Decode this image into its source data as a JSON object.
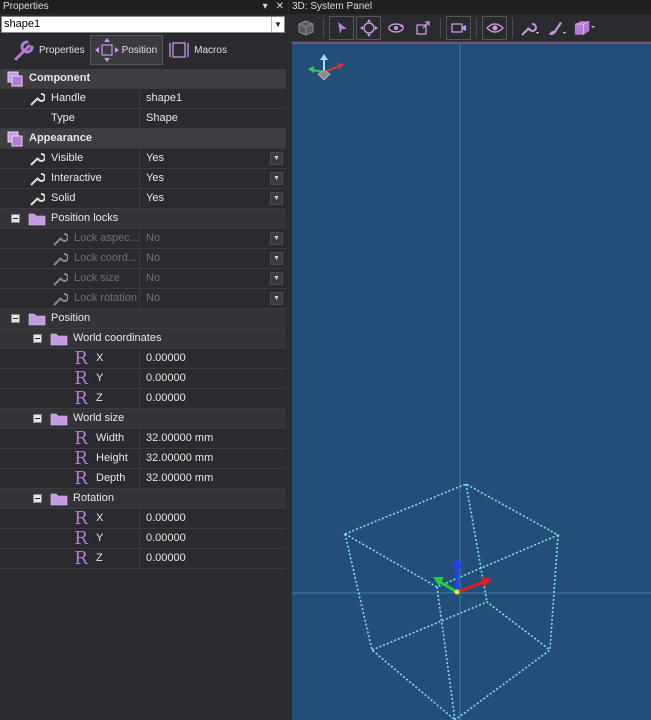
{
  "properties_panel": {
    "title": "Properties",
    "pin_icon": "pin-icon",
    "close_icon": "close-icon",
    "selected_object": "shape1",
    "tabs": [
      {
        "label": "Properties",
        "icon": "wrench-icon",
        "active": false
      },
      {
        "label": "Position",
        "icon": "move-arrows-icon",
        "active": true
      },
      {
        "label": "Macros",
        "icon": "macro-icon",
        "active": false
      }
    ],
    "sections": {
      "component": "Component",
      "appearance": "Appearance",
      "position_locks": "Position locks",
      "position": "Position",
      "world_coordinates": "World coordinates",
      "world_size": "World size",
      "rotation": "Rotation"
    },
    "rows": {
      "handle": {
        "label": "Handle",
        "value": "shape1"
      },
      "type": {
        "label": "Type",
        "value": "Shape"
      },
      "visible": {
        "label": "Visible",
        "value": "Yes"
      },
      "interactive": {
        "label": "Interactive",
        "value": "Yes"
      },
      "solid": {
        "label": "Solid",
        "value": "Yes"
      },
      "lock_aspect": {
        "label": "Lock aspec...",
        "value": "No"
      },
      "lock_coord": {
        "label": "Lock coord...",
        "value": "No"
      },
      "lock_size": {
        "label": "Lock size",
        "value": "No"
      },
      "lock_rotation": {
        "label": "Lock rotation",
        "value": "No"
      },
      "coord_x": {
        "label": "X",
        "value": "0.00000"
      },
      "coord_y": {
        "label": "Y",
        "value": "0.00000"
      },
      "coord_z": {
        "label": "Z",
        "value": "0.00000"
      },
      "width": {
        "label": "Width",
        "value": "32.00000 mm"
      },
      "height": {
        "label": "Height",
        "value": "32.00000 mm"
      },
      "depth": {
        "label": "Depth",
        "value": "32.00000 mm"
      },
      "rot_x": {
        "label": "X",
        "value": "0.00000"
      },
      "rot_y": {
        "label": "Y",
        "value": "0.00000"
      },
      "rot_z": {
        "label": "Z",
        "value": "0.00000"
      }
    },
    "colors": {
      "accent_purple": "#b47ad6",
      "folder": "#c59ae0"
    }
  },
  "system_panel": {
    "title": "3D: System Panel",
    "toolbar_icons": [
      "cube-view-icon",
      "select-arrow-icon",
      "move-icon",
      "rotate-icon",
      "scale-icon",
      "record-icon",
      "eye-icon",
      "wrench-dropdown-icon",
      "brush-dropdown-icon",
      "box-dropdown-icon"
    ],
    "viewport_bg": "#234e78",
    "wireframe_color": "#7fe0ee"
  }
}
